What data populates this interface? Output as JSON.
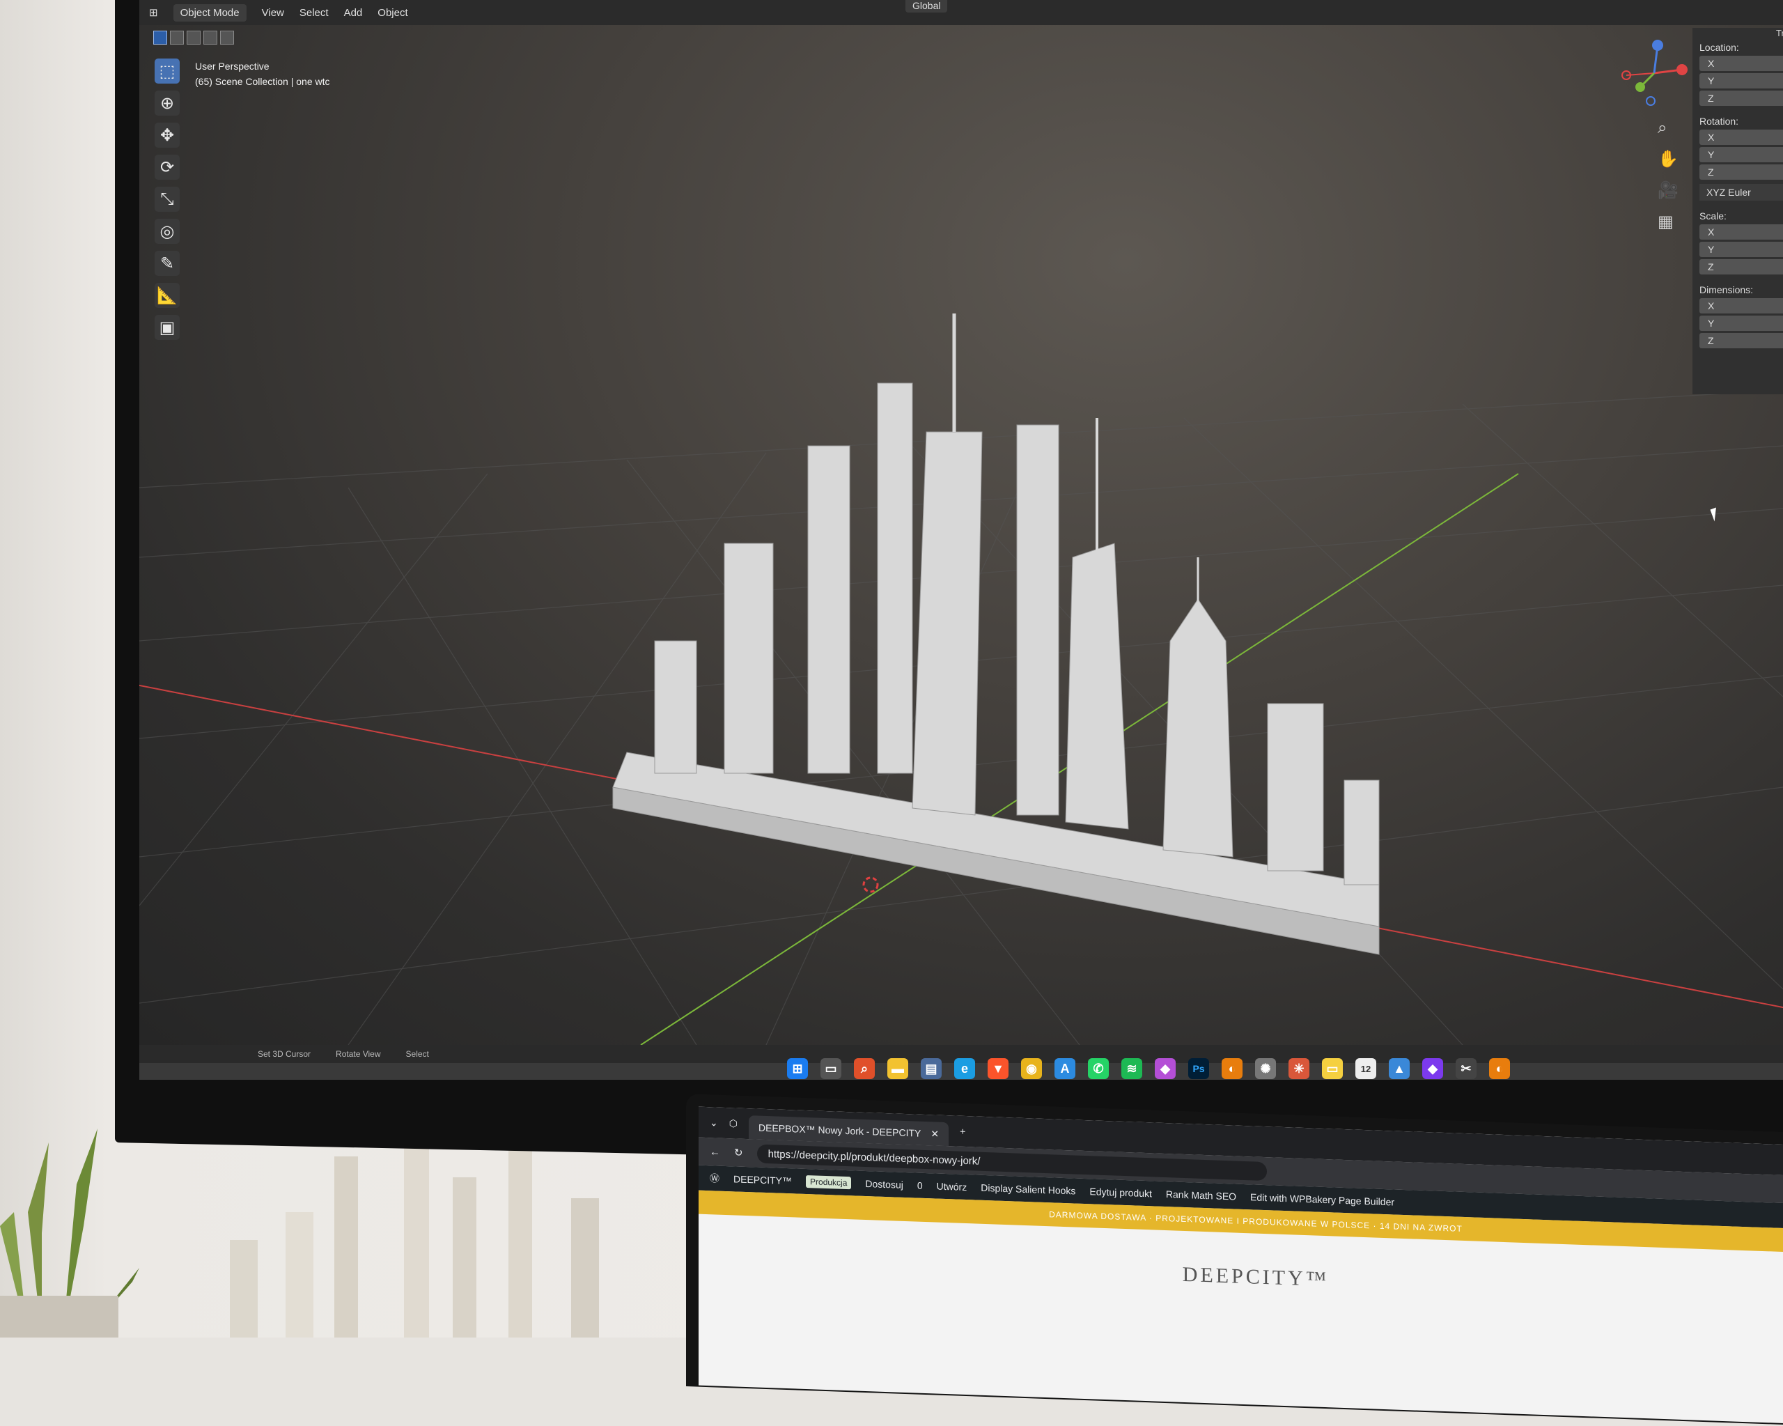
{
  "blender": {
    "header": {
      "mode": "Object Mode",
      "menus": [
        "View",
        "Select",
        "Add",
        "Object"
      ],
      "orientation": "Global"
    },
    "viewport": {
      "view_name": "User Perspective",
      "collection": "(65) Scene Collection | one wtc"
    },
    "toolbar_tools": [
      "select-box",
      "cursor",
      "move",
      "rotate",
      "scale",
      "transform",
      "annotate",
      "measure",
      "add-cube"
    ],
    "n_panel": {
      "tab": "Transform",
      "location_label": "Location:",
      "rotation_label": "Rotation:",
      "rotation_mode": "XYZ Euler",
      "scale_label": "Scale:",
      "dimensions_label": "Dimensions:",
      "axes": [
        "X",
        "Y",
        "Z"
      ]
    },
    "statusbar": [
      "Set 3D Cursor",
      "Rotate View",
      "Select"
    ]
  },
  "taskbar": {
    "icons": [
      "windows-icon",
      "task-view-icon",
      "search-icon",
      "file-explorer-icon",
      "calculator-icon",
      "edge-icon",
      "brave-icon",
      "chrome-icon",
      "app-store-icon",
      "whatsapp-icon",
      "spotify-icon",
      "app-icon",
      "photoshop-icon",
      "blender-icon",
      "chatgpt-icon",
      "claude-icon",
      "notes-icon",
      "calendar-icon",
      "photos-icon",
      "obsidian-icon",
      "snipping-icon",
      "blender-active-icon"
    ],
    "ps_label": "Ps",
    "calendar_day": "12"
  },
  "browser": {
    "tab_title": "DEEPBOX™ Nowy Jork - DEEPCITY",
    "url": "https://deepcity.pl/produkt/deepbox-nowy-jork/",
    "wp_bar": {
      "site_name": "DEEPCITY™",
      "badge": "Produkcja",
      "customize": "Dostosuj",
      "comments": "0",
      "new": "Utwórz",
      "display": "Display Salient Hooks",
      "edit": "Edytuj produkt",
      "seo": "Rank Math SEO",
      "builder": "Edit with WPBakery Page Builder"
    },
    "promo_text": "DARMOWA DOSTAWA · PROJEKTOWANE I PRODUKOWANE W POLSCE · 14 DNI NA ZWROT",
    "logo": "DEEPCITY™"
  },
  "colors": {
    "x_axis": "#c94040",
    "y_axis": "#7cb83a",
    "accent": "#4772b3",
    "promo": "#e5b62b"
  }
}
